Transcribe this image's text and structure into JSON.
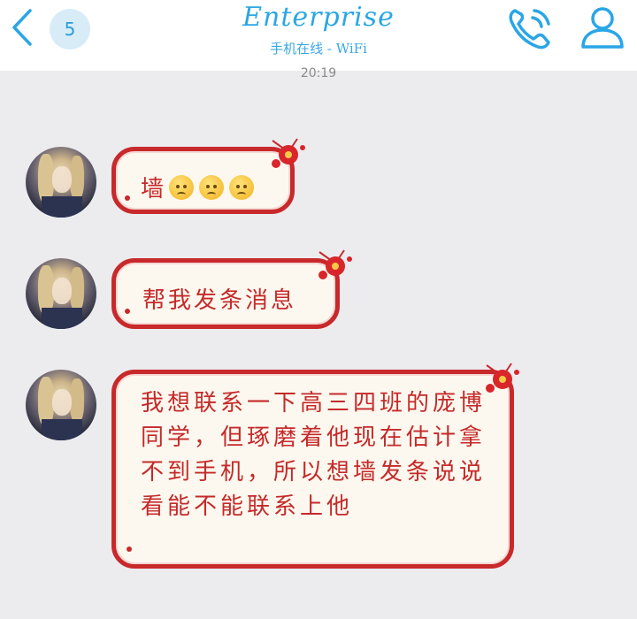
{
  "header": {
    "unread_count": "5",
    "title": "Enterprise",
    "status": "手机在线 - WiFi"
  },
  "chat": {
    "timestamp": "20:19",
    "messages": [
      {
        "text": "墙",
        "emojis": [
          "worried-face",
          "worried-face",
          "worried-face"
        ]
      },
      {
        "text": "帮我发条消息"
      },
      {
        "text": "我想联系一下高三四班的庞博同学，但琢磨着他现在估计拿不到手机，所以想墙发条说说看能不能联系上他"
      }
    ]
  },
  "colors": {
    "accent": "#2aa6e6",
    "bubble_border": "#c8292b",
    "bubble_text": "#c42a2a",
    "bubble_fill": "#fdf8ef",
    "background": "#ececef"
  }
}
